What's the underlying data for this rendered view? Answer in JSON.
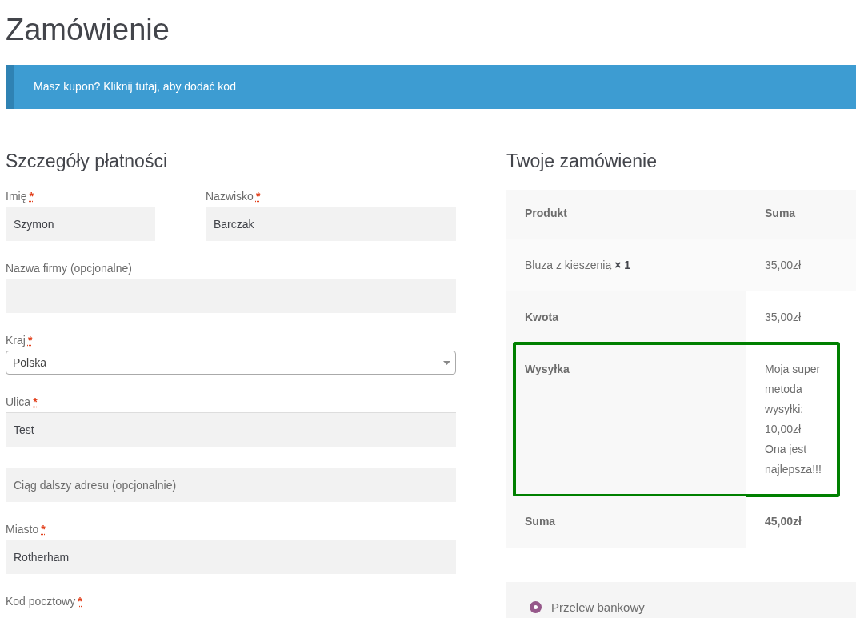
{
  "page_title": "Zamówienie",
  "coupon_notice": "Masz kupon? Kliknij tutaj, aby dodać kod",
  "billing": {
    "title": "Szczegóły płatności",
    "rows": [
      [
        {
          "kind": "text",
          "label": "Imię",
          "required_mark": "*",
          "value": "Szymon"
        },
        {
          "kind": "text",
          "label": "Nazwisko",
          "required_mark": "*",
          "value": "Barczak"
        }
      ],
      [
        {
          "kind": "text",
          "label": "Nazwa firmy (opcjonalne)"
        }
      ],
      [
        {
          "kind": "select",
          "label": "Kraj",
          "required_mark": "*",
          "value": "Polska"
        }
      ],
      [
        {
          "kind": "text",
          "label": "Ulica",
          "required_mark": "*",
          "value": "Test"
        }
      ],
      [
        {
          "kind": "text",
          "placeholder": "Ciąg dalszy adresu (opcjonalnie)"
        }
      ],
      [
        {
          "kind": "text",
          "label": "Miasto",
          "required_mark": "*",
          "value": "Rotherham"
        }
      ],
      [
        {
          "kind": "label-only",
          "label": "Kod pocztowy",
          "required_mark": "*"
        }
      ]
    ]
  },
  "order": {
    "title": "Twoje zamówienie",
    "columns": [
      "Produkt",
      "Suma"
    ],
    "product": {
      "name": "Bluza z kieszenią",
      "quantity": "× 1",
      "total": "35,00zł"
    },
    "totals": [
      {
        "label": "Kwota",
        "lines": [
          "35,00zł"
        ],
        "highlighted": false,
        "strong": false
      },
      {
        "label": "Wysyłka",
        "lines": [
          "Moja super metoda wysyłki: 10,00zł",
          "Ona jest najlepsza!!!"
        ],
        "highlighted": true,
        "strong": false
      },
      {
        "label": "Suma",
        "lines": [
          "45,00zł"
        ],
        "highlighted": false,
        "strong": true
      }
    ]
  },
  "payment_methods": [
    {
      "label": "Przelew bankowy",
      "selected": true
    }
  ]
}
